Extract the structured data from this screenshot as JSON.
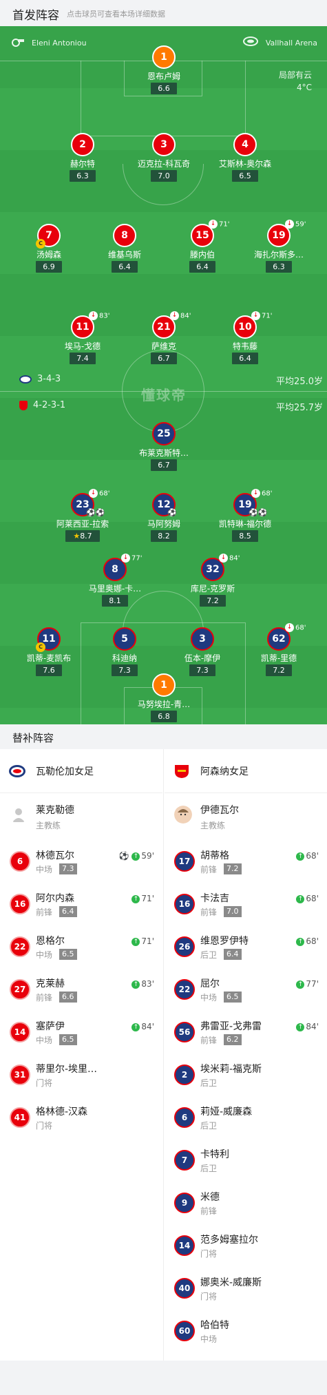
{
  "header": {
    "title": "首发阵容",
    "subtitle": "点击球员可查看本场详细数据"
  },
  "match": {
    "referee": "Eleni Antoniou",
    "venue": "Vallhall Arena",
    "weather": "局部有云",
    "temperature": "4°C",
    "watermark": "懂球帝"
  },
  "home": {
    "formation": "3-4-3",
    "avg_age": "平均25.0岁",
    "players": [
      {
        "num": "1",
        "name": "恩布卢姆",
        "rating": "6.6"
      },
      {
        "num": "2",
        "name": "赫尔特",
        "rating": "6.3"
      },
      {
        "num": "3",
        "name": "迈克拉-科瓦奇",
        "rating": "7.0"
      },
      {
        "num": "4",
        "name": "艾斯林-奥尔森",
        "rating": "6.5"
      },
      {
        "num": "7",
        "name": "汤姆森",
        "rating": "6.9"
      },
      {
        "num": "8",
        "name": "维基乌斯",
        "rating": "6.4"
      },
      {
        "num": "15",
        "name": "滕内伯",
        "rating": "6.4",
        "sub": "71'"
      },
      {
        "num": "19",
        "name": "海扎尔斯多…",
        "rating": "6.3",
        "sub": "59'"
      },
      {
        "num": "11",
        "name": "埃马-戈德",
        "rating": "7.4",
        "sub": "83'"
      },
      {
        "num": "21",
        "name": "萨维克",
        "rating": "6.7",
        "sub": "84'"
      },
      {
        "num": "10",
        "name": "特韦藤",
        "rating": "6.4",
        "sub": "71'"
      }
    ]
  },
  "away": {
    "formation": "4-2-3-1",
    "avg_age": "平均25.7岁",
    "players": [
      {
        "num": "25",
        "name": "布莱克斯特…",
        "rating": "6.7"
      },
      {
        "num": "23",
        "name": "阿莱西亚-拉索",
        "rating": "8.7",
        "sub": "68'"
      },
      {
        "num": "12",
        "name": "马阿努姆",
        "rating": "8.2"
      },
      {
        "num": "19",
        "name": "凯特琳-福尔德",
        "rating": "8.5",
        "sub": "68'"
      },
      {
        "num": "8",
        "name": "马里奥娜-卡…",
        "rating": "8.1",
        "sub": "77'"
      },
      {
        "num": "32",
        "name": "库尼-克罗斯",
        "rating": "7.2",
        "sub": "84'"
      },
      {
        "num": "11",
        "name": "凯蒂-麦凯布",
        "rating": "7.6"
      },
      {
        "num": "5",
        "name": "科迪纳",
        "rating": "7.3"
      },
      {
        "num": "3",
        "name": "伍本-摩伊",
        "rating": "7.3"
      },
      {
        "num": "62",
        "name": "凯蒂-里德",
        "rating": "7.2",
        "sub": "68'"
      },
      {
        "num": "1",
        "name": "马努埃拉-青…",
        "rating": "6.8"
      }
    ]
  },
  "subs": {
    "title": "替补阵容",
    "left": {
      "team": "瓦勒伦加女足",
      "coach": {
        "name": "莱克勒德",
        "role": "主教练"
      },
      "players": [
        {
          "num": "6",
          "name": "林德瓦尔",
          "pos": "中场",
          "rating": "7.3",
          "min": "59'",
          "goal": true
        },
        {
          "num": "16",
          "name": "阿尔内森",
          "pos": "前锋",
          "rating": "6.4",
          "min": "71'"
        },
        {
          "num": "22",
          "name": "恩格尔",
          "pos": "中场",
          "rating": "6.5",
          "min": "71'"
        },
        {
          "num": "27",
          "name": "克莱赫",
          "pos": "前锋",
          "rating": "6.6",
          "min": "83'"
        },
        {
          "num": "14",
          "name": "塞萨伊",
          "pos": "中场",
          "rating": "6.5",
          "min": "84'"
        },
        {
          "num": "31",
          "name": "蒂里尔-埃里…",
          "pos": "门将"
        },
        {
          "num": "41",
          "name": "格林德-汉森",
          "pos": "门将"
        }
      ]
    },
    "right": {
      "team": "阿森纳女足",
      "coach": {
        "name": "伊德瓦尔",
        "role": "主教练"
      },
      "players": [
        {
          "num": "17",
          "name": "胡蒂格",
          "pos": "前锋",
          "rating": "7.2",
          "min": "68'"
        },
        {
          "num": "16",
          "name": "卡法吉",
          "pos": "前锋",
          "rating": "7.0",
          "min": "68'"
        },
        {
          "num": "26",
          "name": "维恩罗伊特",
          "pos": "后卫",
          "rating": "6.4",
          "min": "68'"
        },
        {
          "num": "22",
          "name": "屈尔",
          "pos": "中场",
          "rating": "6.5",
          "min": "77'"
        },
        {
          "num": "56",
          "name": "弗雷亚-戈弗雷",
          "pos": "前锋",
          "rating": "6.2",
          "min": "84'"
        },
        {
          "num": "2",
          "name": "埃米莉-福克斯",
          "pos": "后卫"
        },
        {
          "num": "6",
          "name": "莉娅-威廉森",
          "pos": "后卫"
        },
        {
          "num": "7",
          "name": "卡特利",
          "pos": "后卫"
        },
        {
          "num": "9",
          "name": "米德",
          "pos": "前锋"
        },
        {
          "num": "14",
          "name": "范多姆塞拉尔",
          "pos": "门将"
        },
        {
          "num": "40",
          "name": "娜奥米-威廉斯",
          "pos": "门将"
        },
        {
          "num": "60",
          "name": "哈伯特",
          "pos": "中场"
        }
      ]
    }
  },
  "colors": {
    "pitch": "#3caa4f",
    "home": "#e8000b",
    "away": "#1f3a80",
    "keeper": "#ff7a00"
  }
}
